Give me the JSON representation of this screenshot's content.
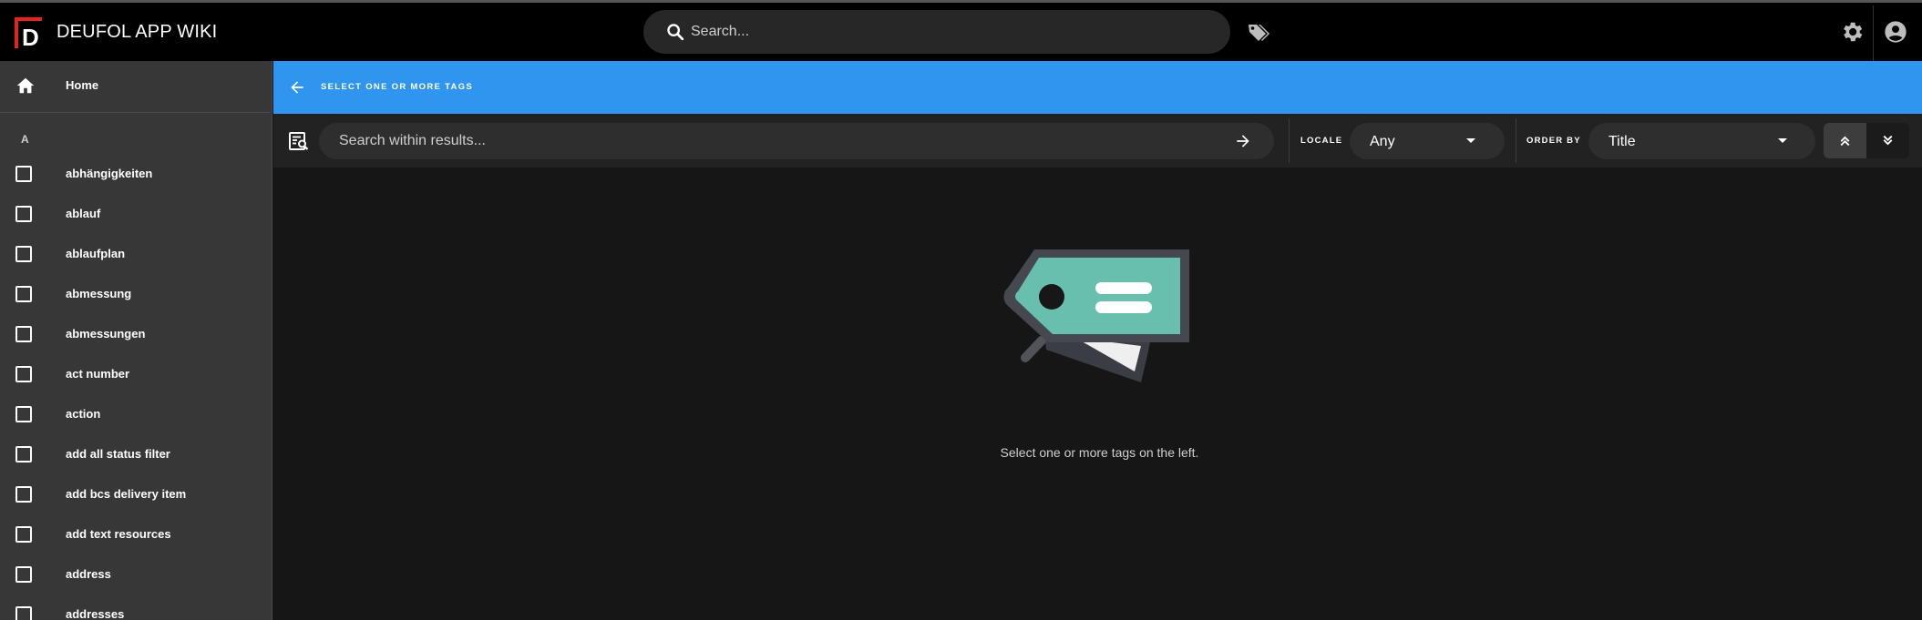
{
  "app": {
    "title": "DEUFOL APP WIKI",
    "logo_letter": "D",
    "accent": "#2f95ee",
    "logo_red": "#e2261f"
  },
  "header": {
    "search_placeholder": "Search...",
    "icons": [
      "search-icon",
      "tags-icon",
      "settings-icon",
      "account-icon"
    ]
  },
  "sidebar": {
    "home_label": "Home",
    "section_letter": "A",
    "tags": [
      {
        "label": "abhängigkeiten",
        "checked": false
      },
      {
        "label": "ablauf",
        "checked": false
      },
      {
        "label": "ablaufplan",
        "checked": false
      },
      {
        "label": "abmessung",
        "checked": false
      },
      {
        "label": "abmessungen",
        "checked": false
      },
      {
        "label": "act number",
        "checked": false
      },
      {
        "label": "action",
        "checked": false
      },
      {
        "label": "add all status filter",
        "checked": false
      },
      {
        "label": "add bcs delivery item",
        "checked": false
      },
      {
        "label": "add text resources",
        "checked": false
      },
      {
        "label": "address",
        "checked": false
      },
      {
        "label": "addresses",
        "checked": false
      }
    ]
  },
  "toolbar": {
    "title": "SELECT ONE OR MORE TAGS"
  },
  "filters": {
    "search_placeholder": "Search within results...",
    "locale_label": "LOCALE",
    "locale_value": "Any",
    "order_label": "ORDER BY",
    "order_value": "Title",
    "sort_direction": "ascending"
  },
  "empty_state": {
    "message": "Select one or more tags on the left.",
    "tag_color": "#69bfae"
  }
}
